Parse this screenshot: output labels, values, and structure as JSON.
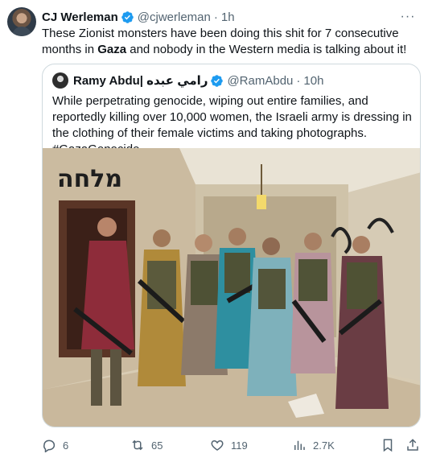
{
  "tweet": {
    "author_name": "CJ Werleman",
    "author_handle": "@cjwerleman",
    "separator": "·",
    "time": "1h",
    "text_part1": "These Zionist monsters have been doing this shit for 7 consecutive months in ",
    "text_bold": "Gaza",
    "text_part2": " and nobody in the Western media is talking about it!",
    "more_icon": "more-horizontal-icon"
  },
  "quoted": {
    "author_name": "Ramy Abdu| رامي عبده",
    "author_handle": "@RamAbdu",
    "separator": "·",
    "time": "10h",
    "text": "While perpetrating genocide, wiping out entire families, and reportedly killing over 10,000 women, the Israeli army is dressing in the clothing of their female victims and taking photographs. #GazaGenocide",
    "photo_graffiti": "מלחה"
  },
  "actions": {
    "replies": "6",
    "reposts": "65",
    "likes": "119",
    "views": "2.7K"
  },
  "colors": {
    "text": "#0f1419",
    "secondary": "#536471",
    "border": "#cfd9de",
    "verified": "#1d9bf0"
  }
}
